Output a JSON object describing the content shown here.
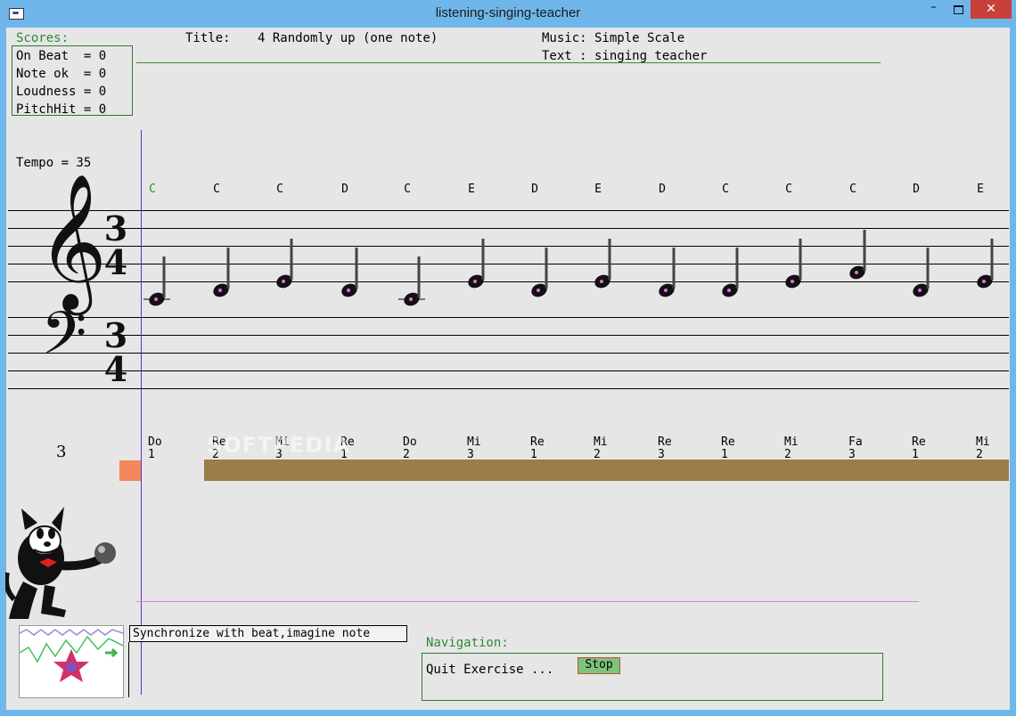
{
  "window": {
    "title": "listening-singing-teacher",
    "minimize": "–",
    "close": "✕"
  },
  "scores": {
    "heading": "Scores:",
    "on_beat": "On Beat  = 0",
    "note_ok": "Note ok  = 0",
    "loudness": "Loudness = 0",
    "pitch_hit": "PitchHit = 0"
  },
  "header": {
    "title_label": "Title:",
    "title_value": "4 Randomly up (one note)",
    "music": "Music: Simple Scale",
    "text": "Text : singing teacher"
  },
  "tempo": "Tempo = 35",
  "beat_counter": "3",
  "notes": [
    {
      "letter": "C",
      "solfa": "Do",
      "beat": "1",
      "active": true
    },
    {
      "letter": "C",
      "solfa": "Re",
      "beat": "2"
    },
    {
      "letter": "C",
      "solfa": "Mi",
      "beat": "3"
    },
    {
      "letter": "D",
      "solfa": "Re",
      "beat": "1"
    },
    {
      "letter": "C",
      "solfa": "Do",
      "beat": "2"
    },
    {
      "letter": "E",
      "solfa": "Mi",
      "beat": "3"
    },
    {
      "letter": "D",
      "solfa": "Re",
      "beat": "1"
    },
    {
      "letter": "E",
      "solfa": "Mi",
      "beat": "2"
    },
    {
      "letter": "D",
      "solfa": "Re",
      "beat": "3"
    },
    {
      "letter": "C",
      "solfa": "Re",
      "beat": "1"
    },
    {
      "letter": "C",
      "solfa": "Mi",
      "beat": "2"
    },
    {
      "letter": "C",
      "solfa": "Fa",
      "beat": "3"
    },
    {
      "letter": "D",
      "solfa": "Re",
      "beat": "1"
    },
    {
      "letter": "E",
      "solfa": "Mi",
      "beat": "2"
    }
  ],
  "time_signature": {
    "top": "3",
    "bottom": "4"
  },
  "watermark": "SOFTPEDIA",
  "instruction": "Synchronize with beat,imagine note",
  "navigation": {
    "heading": "Navigation:",
    "quit_label": "Quit Exercise ...",
    "stop_button": "Stop"
  },
  "colors": {
    "active_note": "#2f8a2f",
    "progress_bar": "#9a7d4a",
    "beat_marker": "#f2875a",
    "playhead": "#5a2fd0"
  }
}
